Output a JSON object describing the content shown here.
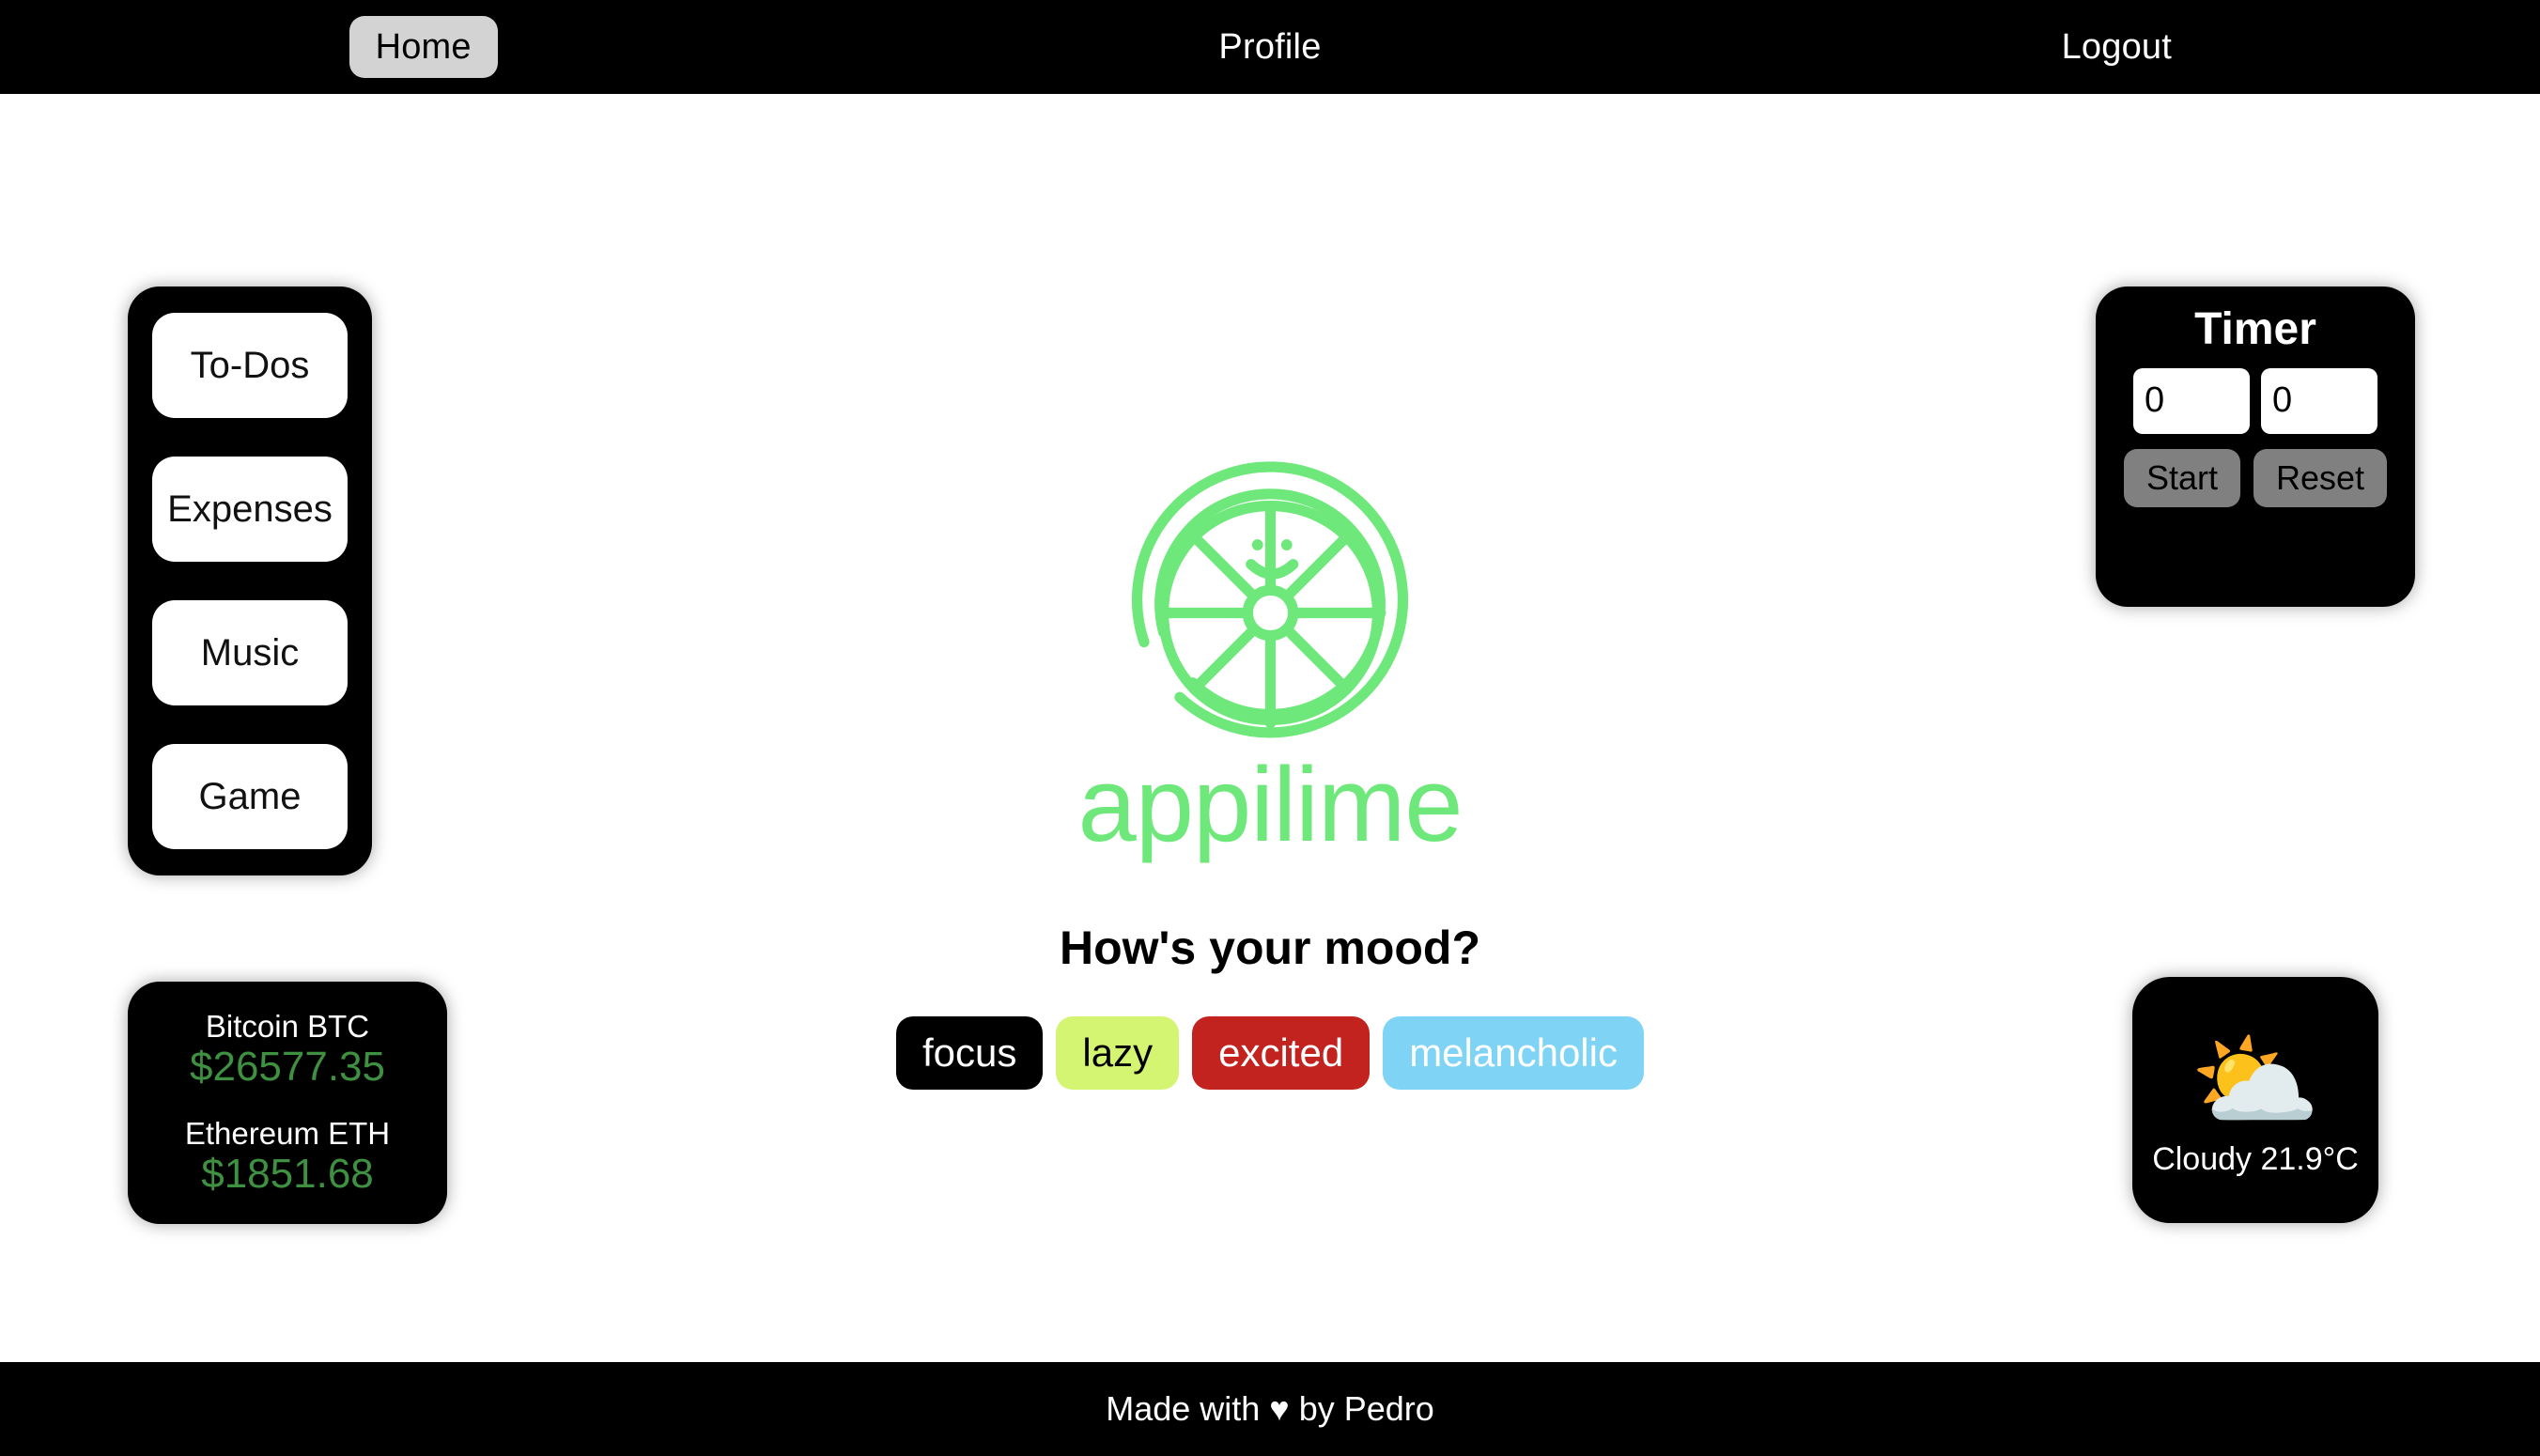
{
  "navbar": {
    "items": [
      {
        "label": "Home",
        "active": true
      },
      {
        "label": "Profile",
        "active": false
      },
      {
        "label": "Logout",
        "active": false
      }
    ]
  },
  "sidebar": {
    "items": [
      {
        "label": "To-Dos"
      },
      {
        "label": "Expenses"
      },
      {
        "label": "Music"
      },
      {
        "label": "Game"
      }
    ]
  },
  "crypto": {
    "coins": [
      {
        "name": "Bitcoin BTC",
        "price": "$26577.35"
      },
      {
        "name": "Ethereum ETH",
        "price": "$1851.68"
      }
    ],
    "price_color": "#3f9142"
  },
  "timer": {
    "title": "Timer",
    "minutes_value": "0",
    "seconds_value": "0",
    "start_label": "Start",
    "reset_label": "Reset"
  },
  "weather": {
    "icon": "sun-behind-cloud-icon",
    "icon_glyph": "⛅",
    "condition_text": "Cloudy 21.9°C"
  },
  "brand": {
    "logo_icon": "lime-slice-smiley-icon",
    "wordmark": "appilime",
    "color": "#6ee87a"
  },
  "mood": {
    "heading": "How's your mood?",
    "options": [
      {
        "label": "focus",
        "bg": "#000000",
        "fg": "#ffffff"
      },
      {
        "label": "lazy",
        "bg": "#d4f571",
        "fg": "#000000"
      },
      {
        "label": "excited",
        "bg": "#c2231f",
        "fg": "#ffffff"
      },
      {
        "label": "melancholic",
        "bg": "#7fd4f5",
        "fg": "#ffffff"
      }
    ]
  },
  "footer": {
    "prefix": "Made with",
    "heart": "♥",
    "suffix": "by Pedro"
  }
}
